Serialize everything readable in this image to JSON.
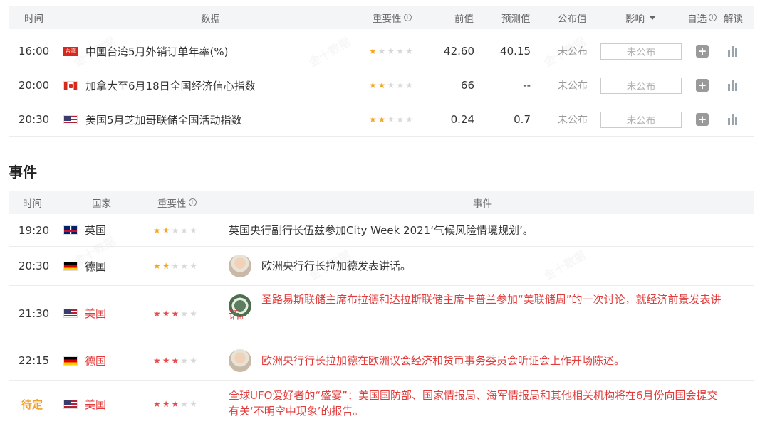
{
  "data_table": {
    "headers": {
      "time": "时间",
      "data": "数据",
      "importance": "重要性",
      "previous": "前值",
      "forecast": "预测值",
      "published": "公布值",
      "impact": "影响",
      "watchlist": "自选",
      "analysis": "解读"
    },
    "rows": [
      {
        "time": "16:00",
        "flag_label": "台湾",
        "title": "中国台湾5月外销订单年率(%)",
        "stars": 1,
        "previous": "42.60",
        "forecast": "40.15",
        "published": "未公布",
        "impact": "未公布"
      },
      {
        "time": "20:00",
        "title": "加拿大至6月18日全国经济信心指数",
        "stars": 2,
        "previous": "66",
        "forecast": "--",
        "published": "未公布",
        "impact": "未公布"
      },
      {
        "time": "20:30",
        "title": "美国5月芝加哥联储全国活动指数",
        "stars": 2,
        "previous": "0.24",
        "forecast": "0.7",
        "published": "未公布",
        "impact": "未公布"
      }
    ]
  },
  "events_heading": "事件",
  "events_table": {
    "headers": {
      "time": "时间",
      "country": "国家",
      "importance": "重要性",
      "event": "事件"
    },
    "rows": [
      {
        "time": "19:20",
        "country": "英国",
        "stars": 2,
        "event": "英国央行副行长伍兹参加City Week 2021‘气候风险情境规划’。"
      },
      {
        "time": "20:30",
        "country": "德国",
        "stars": 2,
        "event": "欧洲央行行长拉加德发表讲话。"
      },
      {
        "time": "21:30",
        "country": "美国",
        "stars": 3,
        "event_line1": "圣路易斯联储主席布拉德和达拉斯联储主席卡普兰参加“美联储周”的一次讨论，就经济前景发表讲",
        "event_line2": "话。"
      },
      {
        "time": "22:15",
        "country": "德国",
        "stars": 3,
        "event": "欧洲央行行长拉加德在欧洲议会经济和货币事务委员会听证会上作开场陈述。"
      },
      {
        "time": "待定",
        "country": "美国",
        "stars": 3,
        "event_line1": "全球UFO爱好者的“盛宴”：美国国防部、国家情报局、海军情报局和其他相关机构将在6月份向国会提交",
        "event_line2": "有关‘不明空中现象’的报告。"
      }
    ]
  },
  "watermark": "金十数据",
  "colors": {
    "star_orange": "#f5a623",
    "star_red": "#e84a4a",
    "event_red": "#e23b3b",
    "pending_orange": "#f0a030",
    "header_bg": "#f4f5f7"
  }
}
